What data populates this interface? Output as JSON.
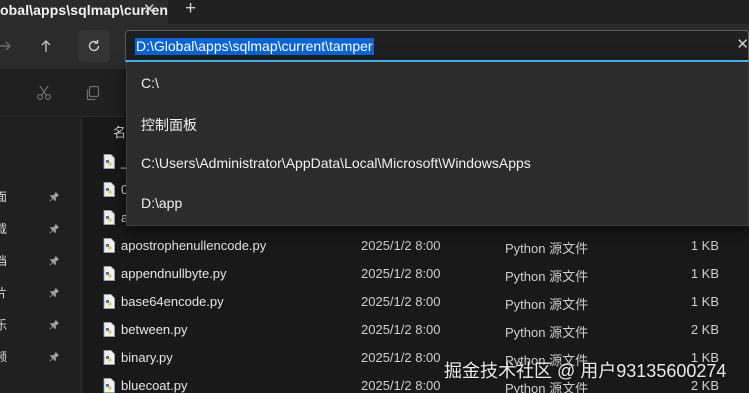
{
  "tab": {
    "title": "obal\\apps\\sqlmap\\curren",
    "close_glyph": "✕",
    "new_tab_glyph": "+"
  },
  "address": {
    "value": "D:\\Global\\apps\\sqlmap\\current\\tamper",
    "clear_glyph": "✕"
  },
  "suggestions": [
    {
      "text": "C:\\"
    },
    {
      "text": "控制面板"
    },
    {
      "text": "C:\\Users\\Administrator\\AppData\\Local\\Microsoft\\WindowsApps"
    },
    {
      "text": "D:\\app"
    }
  ],
  "nav_pane": {
    "header": "",
    "items": [
      {
        "label": "面"
      },
      {
        "label": "载"
      },
      {
        "label": "档"
      },
      {
        "label": "片"
      },
      {
        "label": "乐"
      },
      {
        "label": "频"
      }
    ]
  },
  "list": {
    "name_header": "名"
  },
  "files": [
    {
      "name": "_",
      "date": "",
      "type": "",
      "size": ""
    },
    {
      "name": "0",
      "date": "",
      "type": "",
      "size": ""
    },
    {
      "name": "a",
      "date": "",
      "type": "",
      "size": ""
    },
    {
      "name": "apostrophenullencode.py",
      "date": "2025/1/2 8:00",
      "type": "Python 源文件",
      "size": "1 KB"
    },
    {
      "name": "appendnullbyte.py",
      "date": "2025/1/2 8:00",
      "type": "Python 源文件",
      "size": "1 KB"
    },
    {
      "name": "base64encode.py",
      "date": "2025/1/2 8:00",
      "type": "Python 源文件",
      "size": "1 KB"
    },
    {
      "name": "between.py",
      "date": "2025/1/2 8:00",
      "type": "Python 源文件",
      "size": "2 KB"
    },
    {
      "name": "binary.py",
      "date": "2025/1/2 8:00",
      "type": "Python 源文件",
      "size": "1 KB"
    },
    {
      "name": "bluecoat.py",
      "date": "2025/1/2 8:00",
      "type": "Python 源文件",
      "size": "2 KB"
    }
  ],
  "watermark": "掘金技术社区 @ 用户93135600274",
  "colors": {
    "selection": "#0a64d8",
    "focus_underline": "#4cc2ff",
    "background": "#191919"
  }
}
